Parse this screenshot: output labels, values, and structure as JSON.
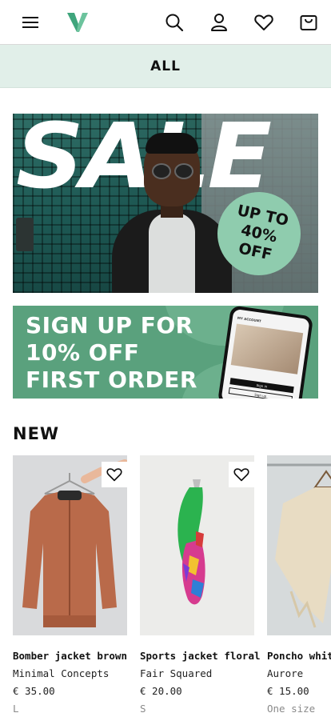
{
  "header": {
    "icons": [
      "menu-icon",
      "logo",
      "search-icon",
      "account-icon",
      "heart-icon",
      "bag-icon"
    ],
    "brand_color": "#3fa57c"
  },
  "category_bar": {
    "label": "ALL",
    "background": "#e1efe9"
  },
  "sale_banner": {
    "headline": "SALE",
    "badge_line1": "UP TO",
    "badge_line2": "40%",
    "badge_line3": "OFF",
    "badge_color": "#8fccae"
  },
  "signup_banner": {
    "line1": "SIGN UP FOR",
    "line2": "10% OFF",
    "line3": "FIRST ORDER",
    "phone_header": "MY ACCOUNT",
    "phone_button_primary": "Sign in",
    "phone_button_secondary": "Sign up",
    "background": "#5aa17d"
  },
  "new_section": {
    "title": "NEW",
    "products": [
      {
        "name": "Bomber jacket brown",
        "brand": "Minimal Concepts",
        "price": "€ 35.00",
        "size": "L"
      },
      {
        "name": "Sports jacket floral",
        "brand": "Fair Squared",
        "price": "€ 20.00",
        "size": "S"
      },
      {
        "name": "Poncho white",
        "brand": "Aurore",
        "price": "€ 15.00",
        "size": "One size"
      }
    ]
  }
}
